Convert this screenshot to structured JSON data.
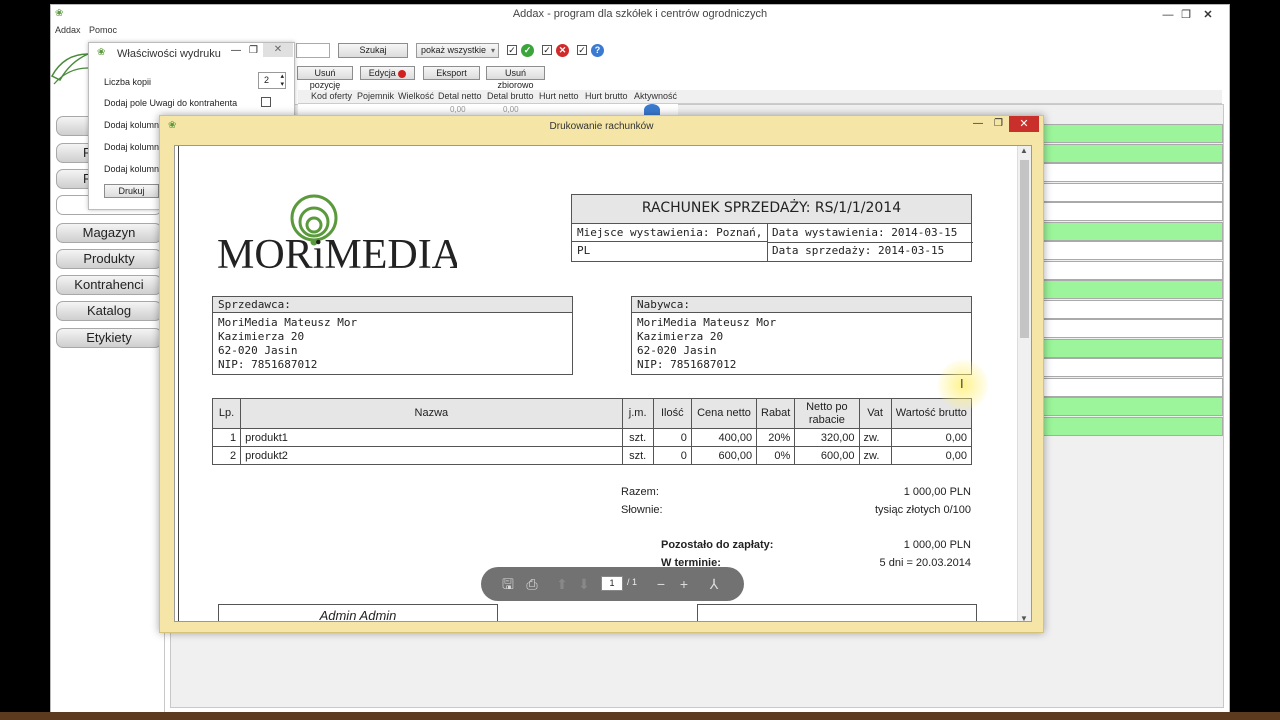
{
  "app": {
    "title": "Addax - program dla szkółek i centrów ogrodniczych",
    "menu": [
      "Addax",
      "Pomoc"
    ],
    "window_controls": {
      "minimize": "—",
      "maximize": "❐",
      "close": "✕"
    }
  },
  "toolbar": {
    "search_button": "Szukaj",
    "filter_select": "pokaż wszystkie",
    "delete_position": "Usuń pozycję",
    "edit": "Edycja",
    "export": "Eksport",
    "bulk_delete": "Usuń zbiorowo"
  },
  "grid": {
    "columns": [
      "Kod oferty",
      "Pojemnik",
      "Wielkość",
      "Detal netto",
      "Detal brutto",
      "Hurt netto",
      "Hurt brutto",
      "Aktywność"
    ],
    "row_colors": [
      "#9cf59a",
      "#9cf59a",
      "#ffffff",
      "#ffffff",
      "#ffffff",
      "#9cf59a",
      "#ffffff",
      "#ffffff",
      "#9cf59a",
      "#ffffff",
      "#ffffff",
      "#9cf59a",
      "#ffffff",
      "#ffffff",
      "#9cf59a",
      "#9cf59a"
    ],
    "price_placeholder": "0,00"
  },
  "nav": {
    "items": [
      "Magazyn",
      "Produkty",
      "Kontrahenci",
      "Katalog",
      "Etykiety"
    ],
    "partial_items": [
      "R",
      "R"
    ]
  },
  "print_properties": {
    "title": "Właściwości wydruku",
    "copies_label": "Liczba kopii",
    "copies_value": "2",
    "remarks_label": "Dodaj pole Uwagi do kontrahenta",
    "column_labels": [
      "Dodaj kolumnę",
      "Dodaj kolumnę",
      "Dodaj kolumnę"
    ],
    "print_button": "Drukuj"
  },
  "print_window": {
    "title": "Drukowanie rachunków"
  },
  "invoice": {
    "logo_text": "MORiMEDIA",
    "title": "RACHUNEK SPRZEDAŻY: RS/1/1/2014",
    "place_label": "Miejsce wystawienia: Poznań, PL",
    "issue_date": "Data wystawienia: 2014-03-15",
    "sale_date": "Data sprzedaży: 2014-03-15",
    "seller": {
      "header": "Sprzedawca:",
      "lines": [
        "MoriMedia Mateusz Mor",
        "Kazimierza 20",
        "62-020 Jasin",
        "NIP: 7851687012"
      ]
    },
    "buyer": {
      "header": "Nabywca:",
      "lines": [
        "MoriMedia Mateusz Mor",
        "Kazimierza 20",
        "62-020 Jasin",
        "NIP: 7851687012"
      ]
    },
    "table": {
      "headers": [
        "Lp.",
        "Nazwa",
        "j.m.",
        "Ilość",
        "Cena netto",
        "Rabat",
        "Netto po rabacie",
        "Vat",
        "Wartość brutto"
      ],
      "rows": [
        [
          "1",
          "produkt1",
          "szt.",
          "0",
          "400,00",
          "20%",
          "320,00",
          "zw.",
          "0,00"
        ],
        [
          "2",
          "produkt2",
          "szt.",
          "0",
          "600,00",
          "0%",
          "600,00",
          "zw.",
          "0,00"
        ]
      ]
    },
    "summary": {
      "total_label": "Razem:",
      "total_value": "1 000,00 PLN",
      "words_label": "Słownie:",
      "words_value": "tysiąc złotych 0/100",
      "due_label": "Pozostało do zapłaty:",
      "due_value": "1 000,00 PLN",
      "term_label": "W terminie:",
      "term_value": "5 dni = 20.03.2014"
    },
    "signature": "Admin Admin"
  },
  "pdf_toolbar": {
    "page_current": "1",
    "page_total": "/ 1"
  },
  "colors": {
    "row_green": "#9cf59a",
    "print_frame": "#f5e6a8",
    "close_red": "#c9302c",
    "logo_green": "#5a9a3c"
  }
}
